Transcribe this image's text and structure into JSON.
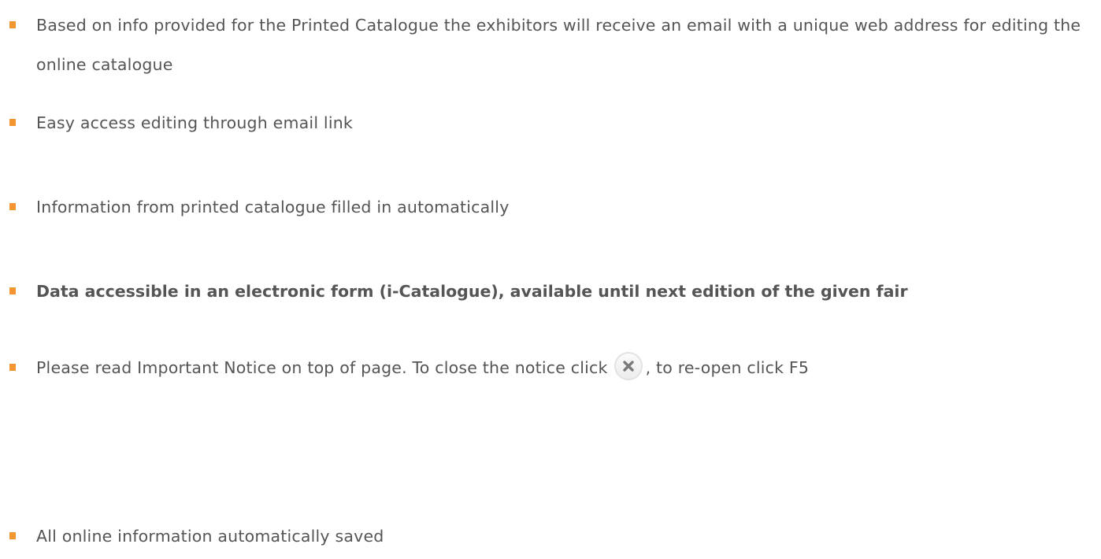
{
  "bullets": [
    {
      "text": "Based on info provided for the Printed Catalogue the exhibitors will receive an email with a unique web address for editing the online catalogue"
    },
    {
      "text": "Easy access editing through email link"
    },
    {
      "text": "Information from printed catalogue filled in automatically"
    },
    {
      "text": "Data accessible in an electronic form (i-Catalogue), available until next edition of the given fair"
    },
    {
      "text_before": "Please read Important Notice on top of page. To close the notice click",
      "icon": "close-icon",
      "text_after": ", to re-open click F5"
    },
    {
      "text": "All online information automatically saved"
    }
  ],
  "colors": {
    "bullet": "#f39530",
    "text": "#555555"
  }
}
